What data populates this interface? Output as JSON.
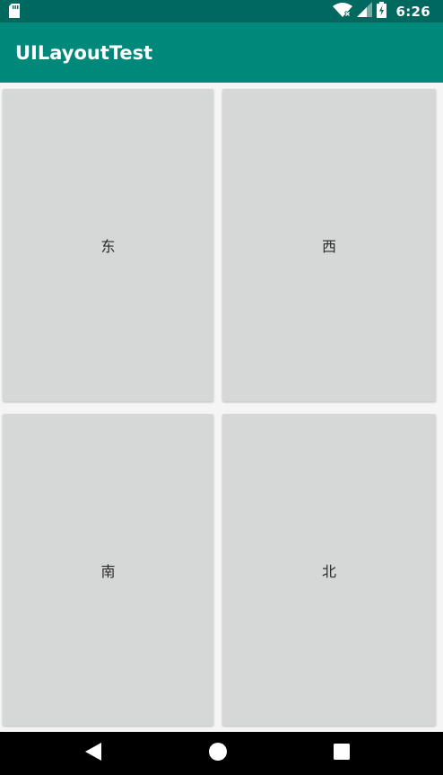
{
  "status_bar": {
    "time": "6:26",
    "icons": [
      "sd-card-icon",
      "wifi-icon",
      "cellular-signal-icon",
      "battery-charging-icon"
    ]
  },
  "app_bar": {
    "title": "UILayoutTest",
    "color": "#00897b",
    "status_color": "#00695f"
  },
  "buttons": {
    "east": "东",
    "west": "西",
    "south": "南",
    "north": "北",
    "color": "#d6d7d7"
  },
  "nav_bar": {
    "icons": [
      "back-icon",
      "home-icon",
      "recents-icon"
    ]
  }
}
